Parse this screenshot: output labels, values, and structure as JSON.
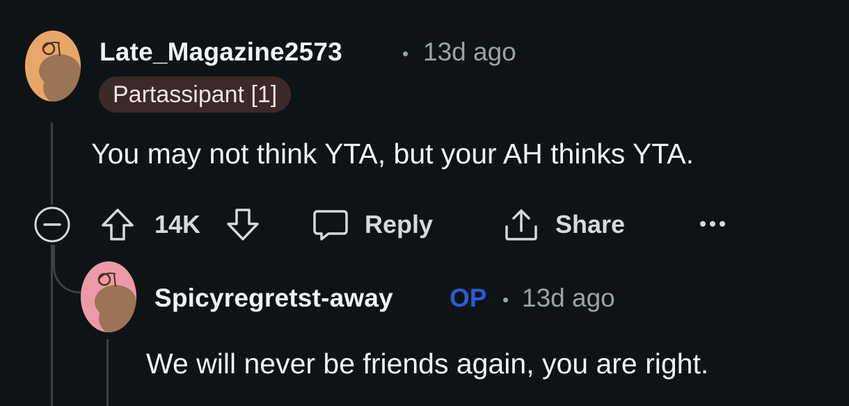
{
  "comment": {
    "author": "Late_Magazine2573",
    "separator": "•",
    "time": "13d ago",
    "flair": "Partassipant [1]",
    "body": "You may not think YTA, but your AH thinks YTA.",
    "avatar_color": "#e8a766"
  },
  "actions": {
    "vote_count": "14K",
    "reply_label": "Reply",
    "share_label": "Share",
    "more_label": "•••"
  },
  "reply": {
    "author": "Spicyregretst-away",
    "op_badge": "OP",
    "separator": "•",
    "time": "13d ago",
    "body": "We will never be friends again, you are right.",
    "avatar_color": "#ec9aa6"
  },
  "colors": {
    "background": "#0e1416",
    "op_blue": "#2a5bd7",
    "muted_text": "#9aa3a8",
    "flair_bg": "#3b2a26"
  },
  "icons": [
    "collapse-icon",
    "upvote-icon",
    "downvote-icon",
    "comment-icon",
    "share-icon",
    "more-icon"
  ]
}
